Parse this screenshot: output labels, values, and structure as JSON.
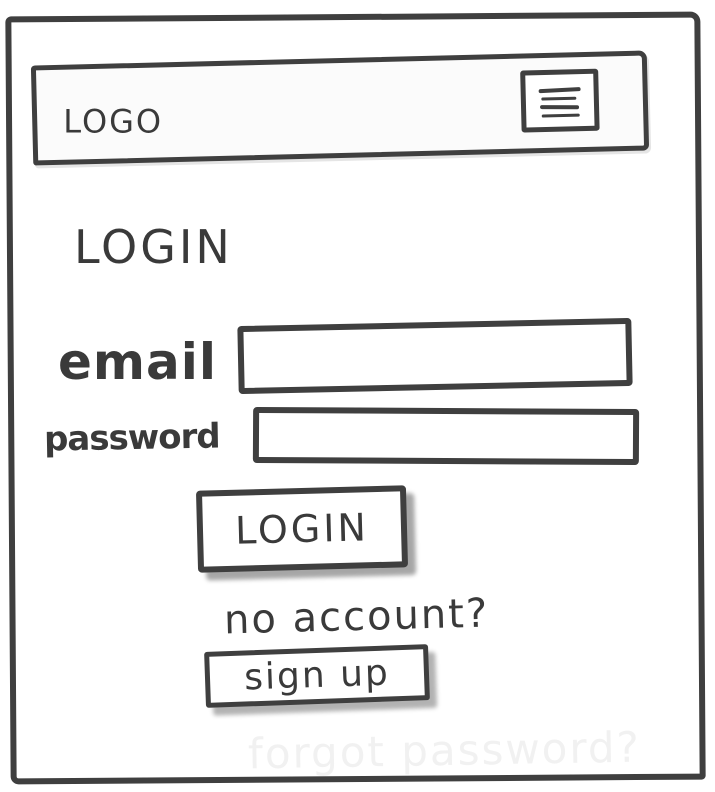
{
  "header": {
    "logo_text": "LOGO",
    "menu_icon": "hamburger-menu-icon"
  },
  "main": {
    "title": "LOGIN",
    "email": {
      "label": "email",
      "value": "",
      "placeholder": ""
    },
    "password": {
      "label": "password",
      "value": "",
      "placeholder": ""
    },
    "login_button_label": "LOGIN",
    "no_account_text": "no account?",
    "signup_button_label": "sign up",
    "forgot_password_text": "forgot password?"
  },
  "colors": {
    "ink": "#3f3f3f",
    "background": "#ffffff",
    "faded_text": "#f1f1f1"
  }
}
